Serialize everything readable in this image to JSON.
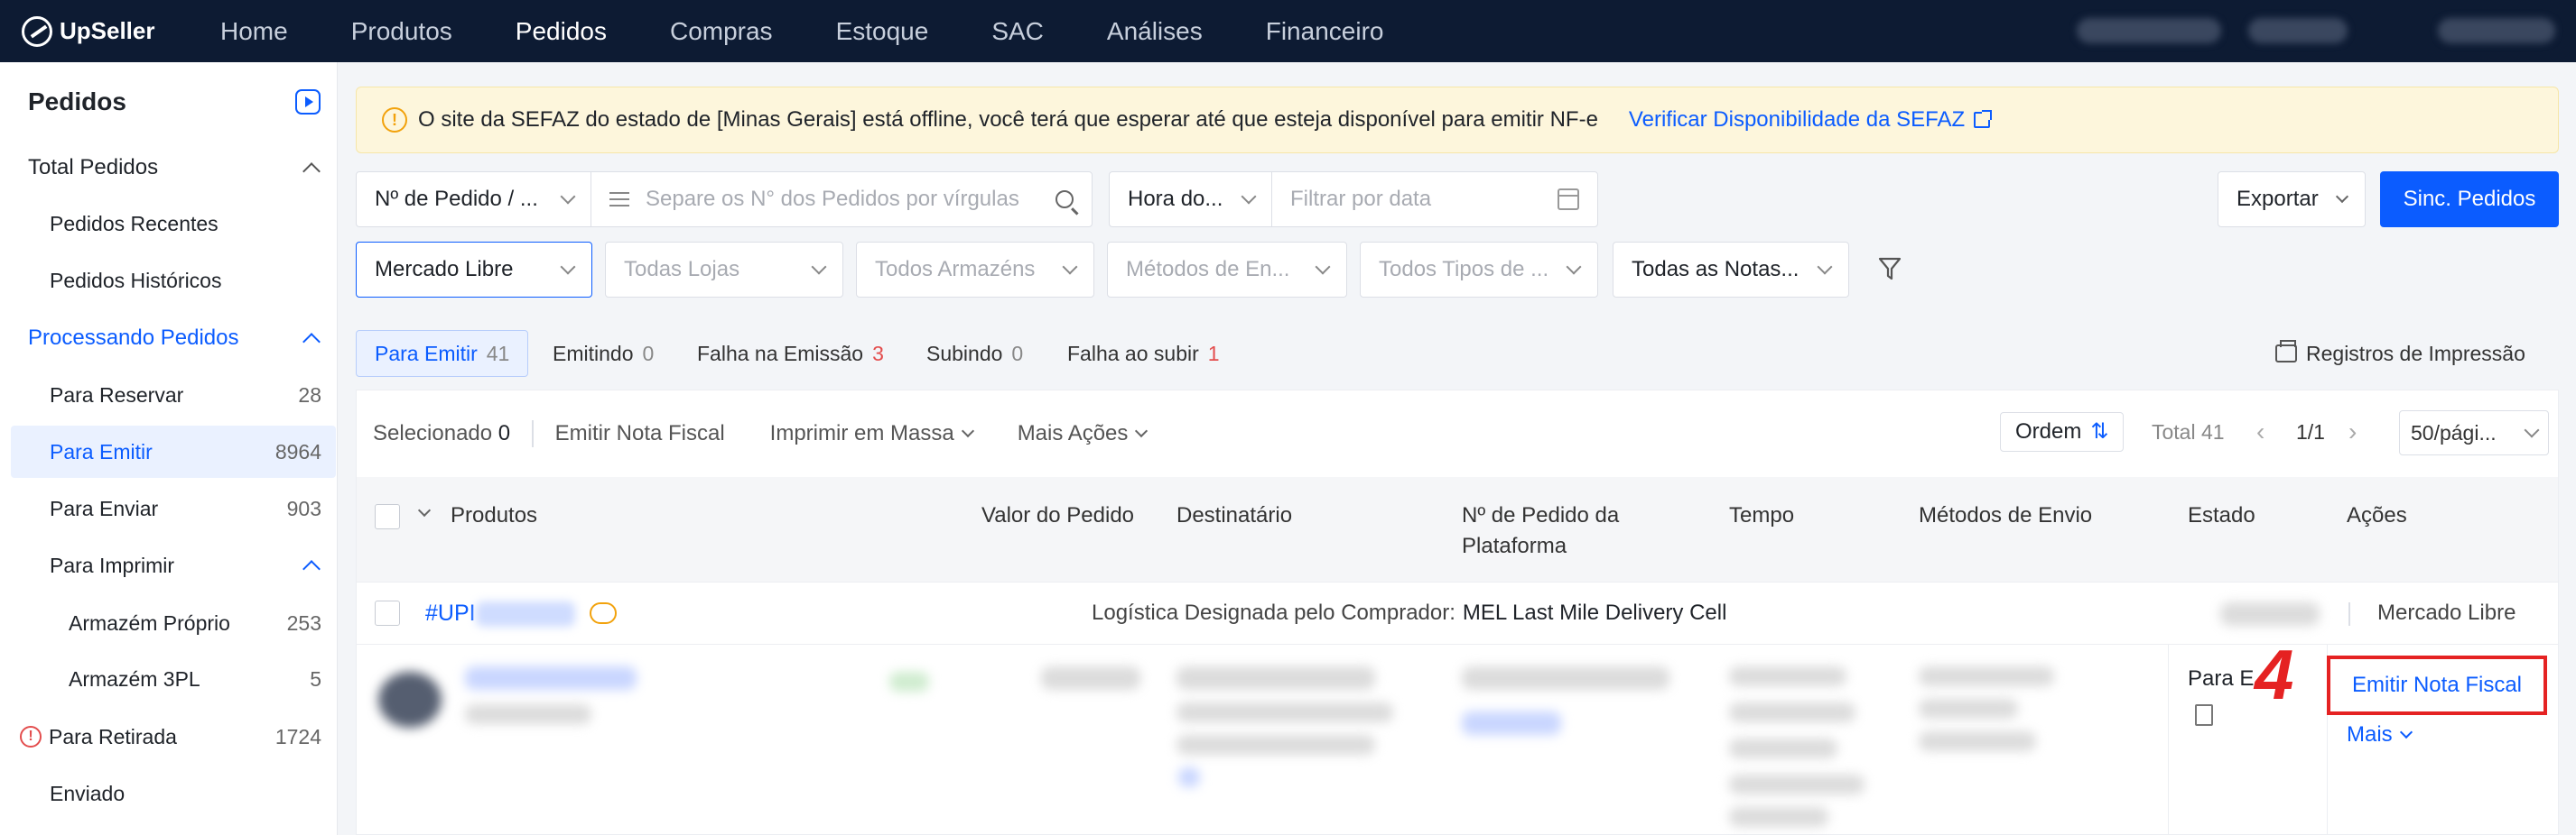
{
  "app": {
    "logo_text": "UpSeller",
    "nav": [
      "Home",
      "Produtos",
      "Pedidos",
      "Compras",
      "Estoque",
      "SAC",
      "Análises",
      "Financeiro"
    ],
    "active_nav": "Pedidos"
  },
  "sidebar": {
    "title": "Pedidos",
    "items": [
      {
        "label": "Total Pedidos",
        "count": ""
      },
      {
        "label": "Pedidos Recentes",
        "count": ""
      },
      {
        "label": "Pedidos Históricos",
        "count": ""
      },
      {
        "label": "Processando Pedidos",
        "count": ""
      },
      {
        "label": "Para Reservar",
        "count": "28"
      },
      {
        "label": "Para Emitir",
        "count": "8964"
      },
      {
        "label": "Para Enviar",
        "count": "903"
      },
      {
        "label": "Para Imprimir",
        "count": ""
      },
      {
        "label": "Armazém Próprio",
        "count": "253"
      },
      {
        "label": "Armazém 3PL",
        "count": "5"
      },
      {
        "label": "Para Retirada",
        "count": "1724"
      },
      {
        "label": "Enviado",
        "count": ""
      }
    ]
  },
  "banner": {
    "message": "O site da SEFAZ do estado de [Minas Gerais] está offline, você terá que esperar até que esteja disponível para emitir NF-e",
    "link": "Verificar Disponibilidade da SEFAZ"
  },
  "filters": {
    "search_type": "Nº de Pedido / ...",
    "search_placeholder": "Separe os N° dos Pedidos por vírgulas",
    "time_type": "Hora do...",
    "date_placeholder": "Filtrar por data",
    "export_label": "Exportar",
    "sync_label": "Sinc. Pedidos",
    "marketplace": "Mercado Libre",
    "stores": "Todas Lojas",
    "warehouses": "Todos Armazéns",
    "shipping": "Métodos de En...",
    "types": "Todos Tipos de ...",
    "invoices": "Todas as Notas..."
  },
  "tabs": [
    {
      "label": "Para Emitir",
      "count": "41"
    },
    {
      "label": "Emitindo",
      "count": "0"
    },
    {
      "label": "Falha na Emissão",
      "count": "3"
    },
    {
      "label": "Subindo",
      "count": "0"
    },
    {
      "label": "Falha ao subir",
      "count": "1"
    }
  ],
  "print_records": "Registros de Impressão",
  "toolbar": {
    "selected_label": "Selecionado",
    "selected_count": "0",
    "emit_label": "Emitir Nota Fiscal",
    "bulk_print": "Imprimir em Massa",
    "more_actions": "Mais Ações",
    "order_label": "Ordem",
    "total": "Total 41",
    "page": "1/1",
    "per_page": "50/pági..."
  },
  "table": {
    "headers": [
      "Produtos",
      "Valor do Pedido",
      "Destinatário",
      "Nº de Pedido da Plataforma",
      "Tempo",
      "Métodos de Envio",
      "Estado",
      "Ações"
    ]
  },
  "order": {
    "id_prefix": "#UPI",
    "logistics_label": "Logística Designada pelo Comprador:",
    "logistics_value": "MEL Last Mile Delivery Cell",
    "marketplace": "Mercado Libre",
    "status": "Para E",
    "step_number": "4",
    "action_emit": "Emitir Nota Fiscal",
    "action_more": "Mais"
  },
  "colors": {
    "primary": "#0b5cff",
    "topbar": "#0d1b33",
    "highlight": "#e52222",
    "warning": "#f2a20c"
  }
}
